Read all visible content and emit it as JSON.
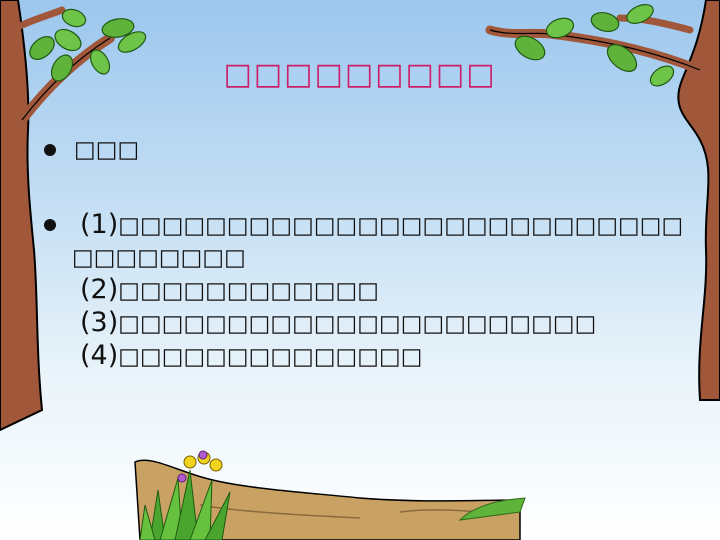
{
  "slide": {
    "title": "□□□□□□□□□",
    "heading": "□□□",
    "items": [
      {
        "num": "(1)",
        "text": "□□□□□□□□□□□□□□□□□□□□□□□□□□",
        "cont": "□□□□□□□□"
      },
      {
        "num": "(2)",
        "text": "□□□□□□□□□□□□"
      },
      {
        "num": "(3)",
        "text": "□□□□□□□□□□□□□□□□□□□□□□"
      },
      {
        "num": "(4)",
        "text": "□□□□□□□□□□□□□□"
      }
    ]
  },
  "colors": {
    "title": "#cc1f6a",
    "trunk": "#a0573a",
    "leaf": "#5fb33a",
    "ground": "#c9a263"
  },
  "illustrations": [
    "left-tree-icon",
    "right-tree-icon",
    "ground-mound-icon",
    "grass-tuft-icon",
    "flower-icon"
  ]
}
